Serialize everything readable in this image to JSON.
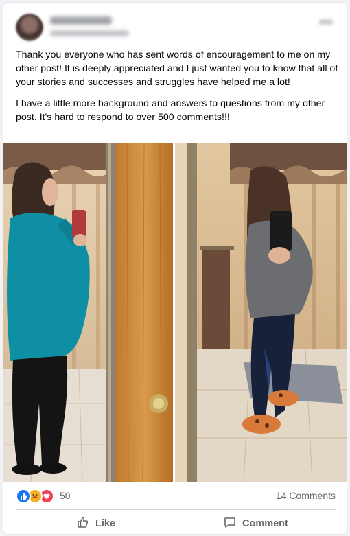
{
  "post": {
    "paragraphs": [
      "Thank you everyone who has sent words of encouragement to me on my other post! It is deeply appreciated and I just wanted you to know that all of your stories and successes and struggles have helped me a lot!",
      "I have a little more background and answers to questions from my other post. It's hard to respond to over 500 comments!!!"
    ]
  },
  "photos": [
    {
      "icon": "before-photo",
      "subject_color": "#0f8fa3"
    },
    {
      "icon": "after-photo",
      "subject_color": "#6b6d70"
    }
  ],
  "stats": {
    "reaction_icons": [
      "like-icon",
      "care-icon",
      "love-icon"
    ],
    "reaction_count": "50",
    "comments": "14 Comments"
  },
  "actions": {
    "like_label": "Like",
    "comment_label": "Comment"
  },
  "colors": {
    "like_blue": "#1877f2",
    "care_yellow": "#f7b125",
    "love_red": "#f33e58",
    "secondary_text": "#65676b"
  }
}
